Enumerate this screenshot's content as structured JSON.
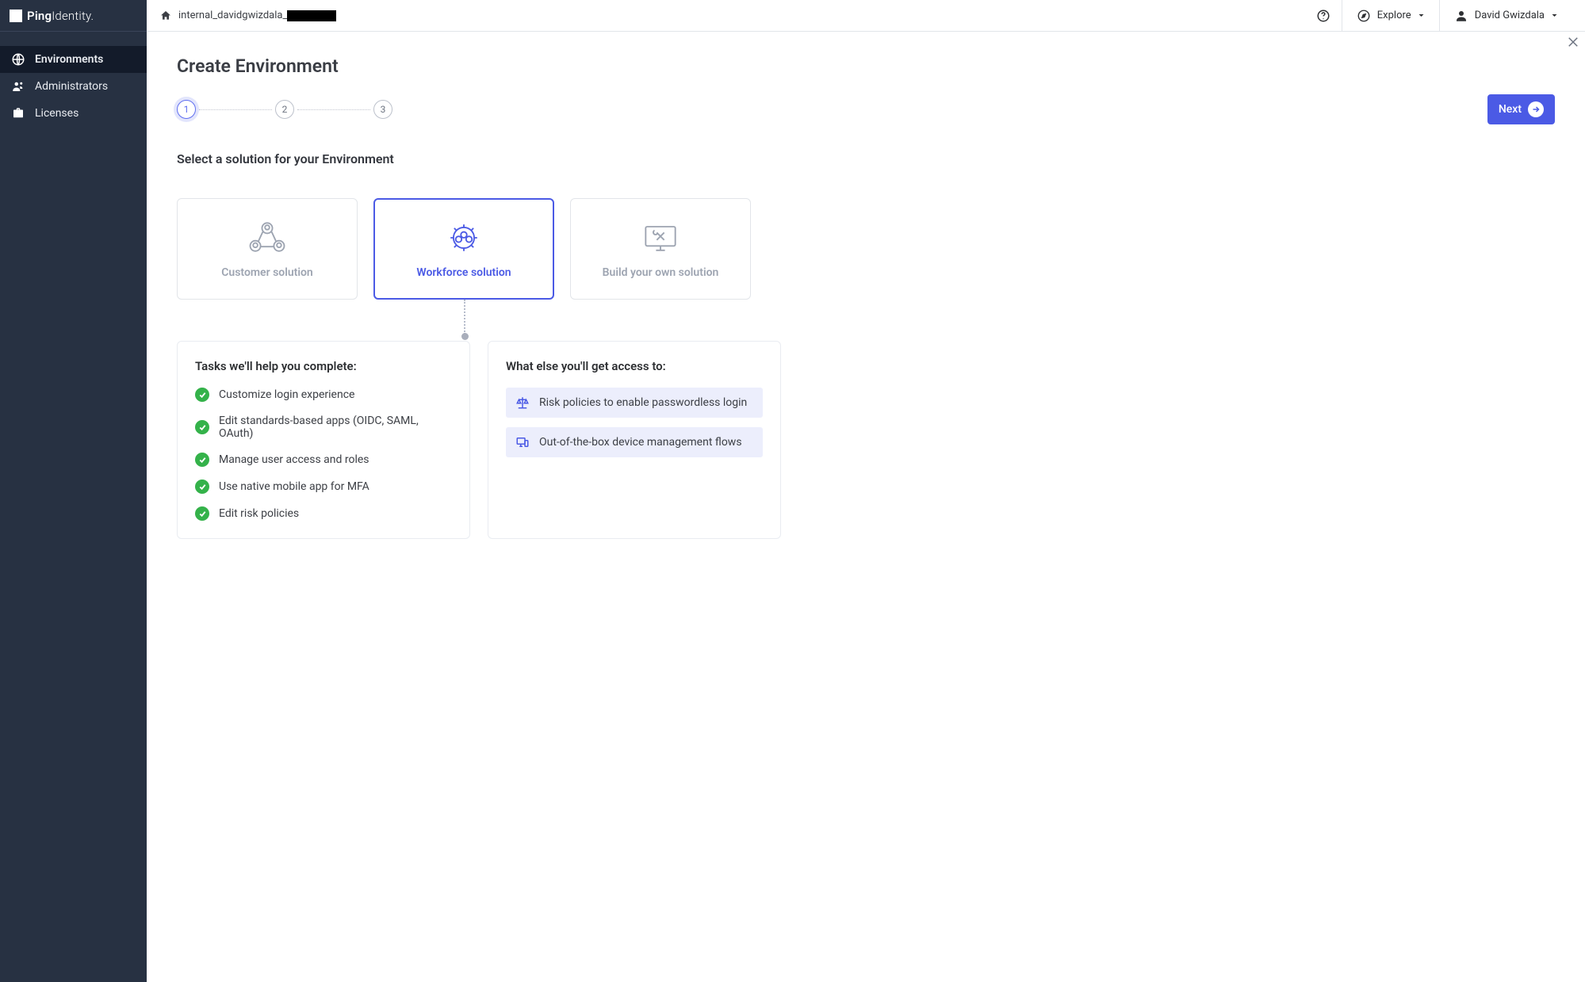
{
  "brand": {
    "name_strong": "Ping",
    "name_light": "Identity."
  },
  "sidebar": {
    "items": [
      {
        "label": "Environments",
        "icon": "globe-icon",
        "active": true
      },
      {
        "label": "Administrators",
        "icon": "admin-icon",
        "active": false
      },
      {
        "label": "Licenses",
        "icon": "briefcase-icon",
        "active": false
      }
    ]
  },
  "topbar": {
    "breadcrumb_prefix": "internal_davidgwizdala_",
    "explore_label": "Explore",
    "user_name": "David Gwizdala"
  },
  "page": {
    "title": "Create Environment",
    "next_label": "Next",
    "steps": [
      "1",
      "2",
      "3"
    ],
    "active_step_index": 0,
    "prompt": "Select a solution for your Environment"
  },
  "solutions": [
    {
      "label": "Customer solution",
      "selected": false
    },
    {
      "label": "Workforce solution",
      "selected": true
    },
    {
      "label": "Build your own solution",
      "selected": false
    }
  ],
  "tasks_title": "Tasks we'll help you complete:",
  "tasks": [
    "Customize login experience",
    "Edit standards-based apps (OIDC, SAML, OAuth)",
    "Manage user access and roles",
    "Use native mobile app for MFA",
    "Edit risk policies"
  ],
  "access_title": "What else you'll get access to:",
  "access": [
    "Risk policies to enable passwordless login",
    "Out-of-the-box device management flows"
  ]
}
